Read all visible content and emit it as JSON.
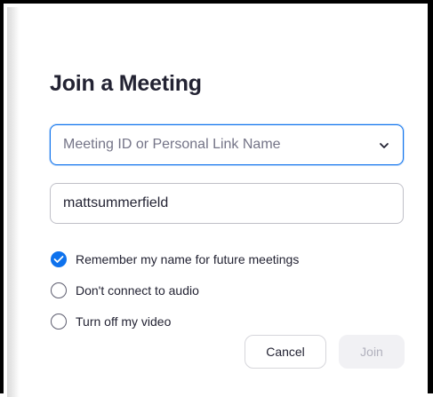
{
  "dialog": {
    "title": "Join a Meeting"
  },
  "meeting_field": {
    "placeholder": "Meeting ID or Personal Link Name",
    "icon": "chevron-down-icon"
  },
  "name_field": {
    "value": "mattsummerfield"
  },
  "options": [
    {
      "label": "Remember my name for future meetings",
      "checked": true
    },
    {
      "label": "Don't connect to audio",
      "checked": false
    },
    {
      "label": "Turn off my video",
      "checked": false
    }
  ],
  "buttons": {
    "cancel": "Cancel",
    "join": "Join",
    "join_enabled": false
  },
  "colors": {
    "accent": "#0e72ed",
    "title_text": "#232333",
    "placeholder_text": "#747487",
    "disabled_text": "#b1b1bd",
    "disabled_bg": "#f1f1f4"
  }
}
